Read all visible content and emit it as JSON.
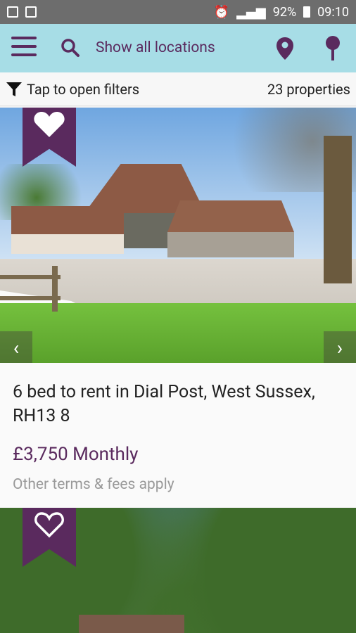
{
  "status_bar": {
    "battery": "92%",
    "time": "09:10"
  },
  "app_bar": {
    "location_text": "Show all locations",
    "icons": [
      "menu-icon",
      "search-icon",
      "map-pin-icon",
      "location-marker-icon"
    ]
  },
  "filter_bar": {
    "filter_label": "Tap to open filters",
    "count": "23 properties"
  },
  "listings": [
    {
      "title": "6 bed to rent in Dial Post, West Sussex, RH13 8",
      "price": "£3,750 Monthly",
      "terms": "Other terms & fees apply",
      "favorited": true
    },
    {
      "favorited": false
    }
  ],
  "colors": {
    "brand_purple": "#5a2a5e",
    "app_bar_bg": "#a7dde6",
    "status_bar_bg": "#6d6d6d"
  }
}
